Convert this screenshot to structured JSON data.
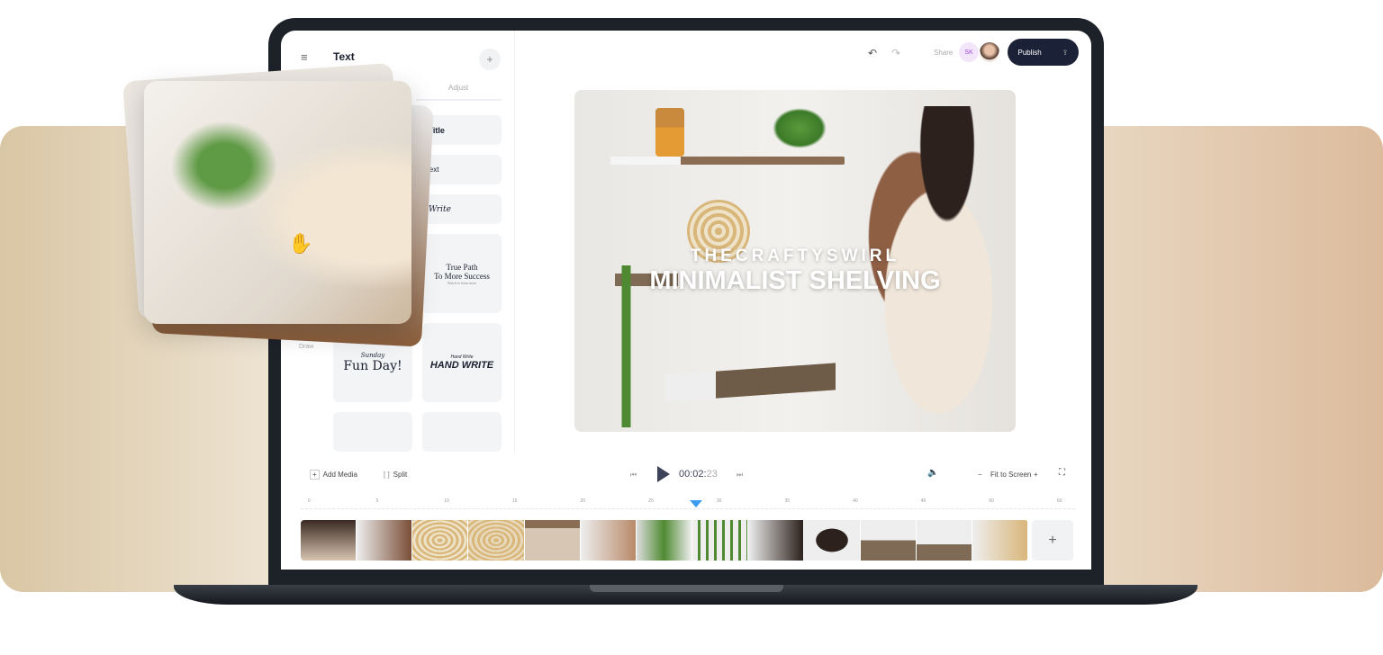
{
  "sidebar": {
    "title": "Text",
    "tab_adjust": "Adjust",
    "items": [
      "e Title",
      "r Text",
      "y Write"
    ],
    "tpl_true_path": "True Path",
    "tpl_more_success": "To More Success",
    "tpl_sub": "Watch to learn more",
    "tpl_sunday": "Sunday",
    "tpl_fun_day": "Fun Day!",
    "tpl_hand_small": "Hand Write",
    "tpl_hand_write": "HAND WRITE",
    "draw_label": "Draw"
  },
  "header": {
    "share": "Share",
    "avatar_initials": "SK",
    "publish": "Publish"
  },
  "canvas": {
    "overline": "THECRAFTYSWIRL",
    "title": "MINIMALIST SHELVING"
  },
  "timeline": {
    "add_media": "Add Media",
    "split": "Split",
    "time_main": "00:02:",
    "time_frames": "23",
    "fit": "Fit to Screen",
    "ticks": [
      "0",
      "5",
      "10",
      "15",
      "20",
      "25",
      "30",
      "35",
      "40",
      "45",
      "50",
      "60"
    ],
    "playhead_seconds": 28.5
  },
  "colors": {
    "publish_bg": "#1b2238",
    "playhead": "#3b9cf0",
    "avatar_bg": "#f3e6fb",
    "avatar_text": "#a24cd6"
  }
}
